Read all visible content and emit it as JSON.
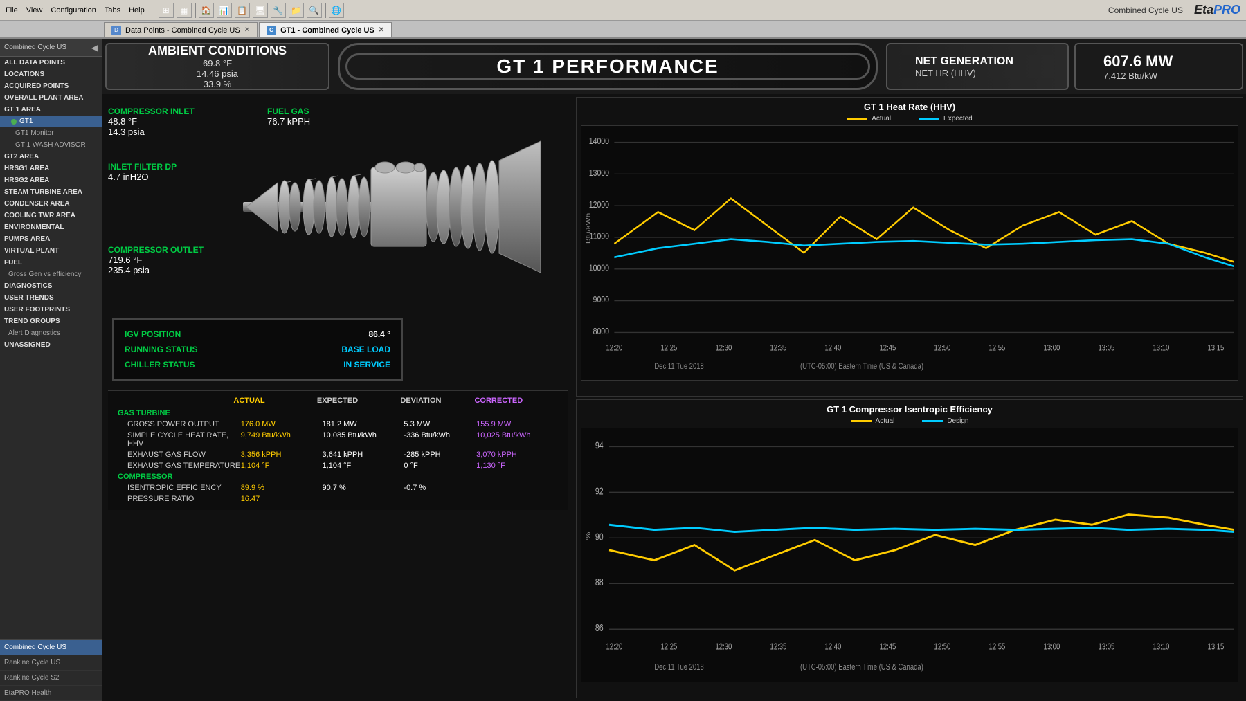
{
  "app": {
    "title": "Combined Cycle US",
    "branding": "Combined Cycle US",
    "logo": "EtaPRO"
  },
  "menu": {
    "items": [
      "File",
      "View",
      "Configuration",
      "Tabs",
      "Help"
    ]
  },
  "tabs": [
    {
      "label": "Data Points - Combined Cycle US",
      "active": false,
      "type": "data"
    },
    {
      "label": "GT1 - Combined Cycle US",
      "active": true,
      "type": "gt"
    }
  ],
  "sidebar": {
    "header": "Combined Cycle US",
    "items": [
      {
        "label": "ALL DATA POINTS",
        "level": 0,
        "bold": true
      },
      {
        "label": "LOCATIONS",
        "level": 0,
        "bold": true
      },
      {
        "label": "ACQUIRED POINTS",
        "level": 0,
        "bold": true
      },
      {
        "label": "OVERALL PLANT AREA",
        "level": 0,
        "bold": true
      },
      {
        "label": "GT 1 AREA",
        "level": 0,
        "bold": true
      },
      {
        "label": "GT1",
        "level": 1,
        "selected": true
      },
      {
        "label": "GT1 Monitor",
        "level": 2
      },
      {
        "label": "GT 1 WASH ADVISOR",
        "level": 2
      },
      {
        "label": "GT2 AREA",
        "level": 0
      },
      {
        "label": "HRSG1 AREA",
        "level": 0
      },
      {
        "label": "HRSG2 AREA",
        "level": 0
      },
      {
        "label": "STEAM TURBINE AREA",
        "level": 0
      },
      {
        "label": "CONDENSER AREA",
        "level": 0
      },
      {
        "label": "COOLING TWR AREA",
        "level": 0
      },
      {
        "label": "ENVIRONMENTAL",
        "level": 0
      },
      {
        "label": "PUMPS AREA",
        "level": 0
      },
      {
        "label": "VIRTUAL PLANT",
        "level": 0
      },
      {
        "label": "FUEL",
        "level": 0
      },
      {
        "label": "Gross Gen vs efficiency",
        "level": 0
      },
      {
        "label": "DIAGNOSTICS",
        "level": 0
      },
      {
        "label": "USER TRENDS",
        "level": 0
      },
      {
        "label": "USER FOOTPRINTS",
        "level": 0
      },
      {
        "label": "TREND GROUPS",
        "level": 0
      },
      {
        "label": "Alert Diagnostics",
        "level": 0
      },
      {
        "label": "UNASSIGNED",
        "level": 0
      }
    ],
    "bottom_items": [
      {
        "label": "Combined Cycle US",
        "active": true
      },
      {
        "label": "Rankine Cycle US",
        "active": false
      },
      {
        "label": "Rankine Cycle S2",
        "active": false
      },
      {
        "label": "EtaPRO Health",
        "active": false
      }
    ]
  },
  "header": {
    "ambient": {
      "title": "AMBIENT CONDITIONS",
      "temp": "69.8 °F",
      "pressure": "14.46 psia",
      "humidity": "33.9 %"
    },
    "gt_title": "GT 1 PERFORMANCE",
    "netgen": {
      "label": "NET GENERATION",
      "sublabel": "NET HR (HHV)"
    },
    "power": {
      "mw": "607.6 MW",
      "btu": "7,412 Btu/kW"
    }
  },
  "compressor": {
    "inlet": {
      "label": "COMPRESSOR INLET",
      "temp": "48.8 °F",
      "pressure": "14.3 psia"
    },
    "fuel_gas": {
      "label": "FUEL GAS",
      "value": "76.7 kPPH"
    },
    "inlet_filter": {
      "label": "INLET FILTER DP",
      "value": "4.7 inH2O"
    },
    "outlet": {
      "label": "COMPRESSOR OUTLET",
      "temp": "719.6 °F",
      "pressure": "235.4 psia"
    }
  },
  "status": {
    "igv_label": "IGV POSITION",
    "igv_value": "86.4 °",
    "running_label": "RUNNING STATUS",
    "running_value": "BASE LOAD",
    "chiller_label": "CHILLER STATUS",
    "chiller_value": "IN SERVICE"
  },
  "charts": {
    "heat_rate": {
      "title": "GT 1 Heat Rate (HHV)",
      "actual_label": "Actual",
      "expected_label": "Expected",
      "y_axis": {
        "min": 8000,
        "max": 14000,
        "label": "Btu/kWh"
      },
      "x_axis": {
        "labels": [
          "12:20",
          "12:25",
          "12:30",
          "12:35",
          "12:40",
          "12:45",
          "12:50",
          "12:55",
          "13:00",
          "13:05",
          "13:10",
          "13:15"
        ],
        "date_label": "Dec 11 Tue 2018",
        "tz_label": "(UTC-05:00) Eastern Time (US & Canada)"
      }
    },
    "isentropic": {
      "title": "GT 1 Compressor Isentropic Efficiency",
      "actual_label": "Actual",
      "design_label": "Design",
      "y_axis": {
        "min": 86,
        "max": 94,
        "label": "%"
      },
      "x_axis": {
        "labels": [
          "12:20",
          "12:25",
          "12:30",
          "12:35",
          "12:40",
          "12:45",
          "12:50",
          "12:55",
          "13:00",
          "13:05",
          "13:10",
          "13:15"
        ],
        "date_label": "Dec 11 Tue 2018",
        "tz_label": "(UTC-05:00) Eastern Time (US & Canada)"
      }
    }
  },
  "data_table": {
    "columns": {
      "name": "",
      "actual": "ACTUAL",
      "expected": "EXPECTED",
      "deviation": "DEVIATION",
      "corrected": "CORRECTED"
    },
    "sections": [
      {
        "label": "GAS TURBINE",
        "rows": [
          {
            "name": "GROSS POWER OUTPUT",
            "actual": "176.0 MW",
            "expected": "181.2 MW",
            "deviation": "5.3 MW",
            "corrected": "155.9 MW"
          },
          {
            "name": "SIMPLE CYCLE HEAT RATE, HHV",
            "actual": "9,749 Btu/kWh",
            "expected": "10,085 Btu/kWh",
            "deviation": "-336 Btu/kWh",
            "corrected": "10,025 Btu/kWh"
          },
          {
            "name": "EXHAUST GAS FLOW",
            "actual": "3,356 kPPH",
            "expected": "3,641 kPPH",
            "deviation": "-285 kPPH",
            "corrected": "3,070 kPPH"
          },
          {
            "name": "EXHAUST GAS TEMPERATURE",
            "actual": "1,104 °F",
            "expected": "1,104 °F",
            "deviation": "0 °F",
            "corrected": "1,130 °F"
          }
        ]
      },
      {
        "label": "COMPRESSOR",
        "rows": [
          {
            "name": "ISENTROPIC EFFICIENCY",
            "actual": "89.9 %",
            "expected": "90.7 %",
            "deviation": "-0.7 %",
            "corrected": ""
          },
          {
            "name": "PRESSURE RATIO",
            "actual": "16.47",
            "expected": "",
            "deviation": "",
            "corrected": ""
          }
        ]
      }
    ]
  }
}
